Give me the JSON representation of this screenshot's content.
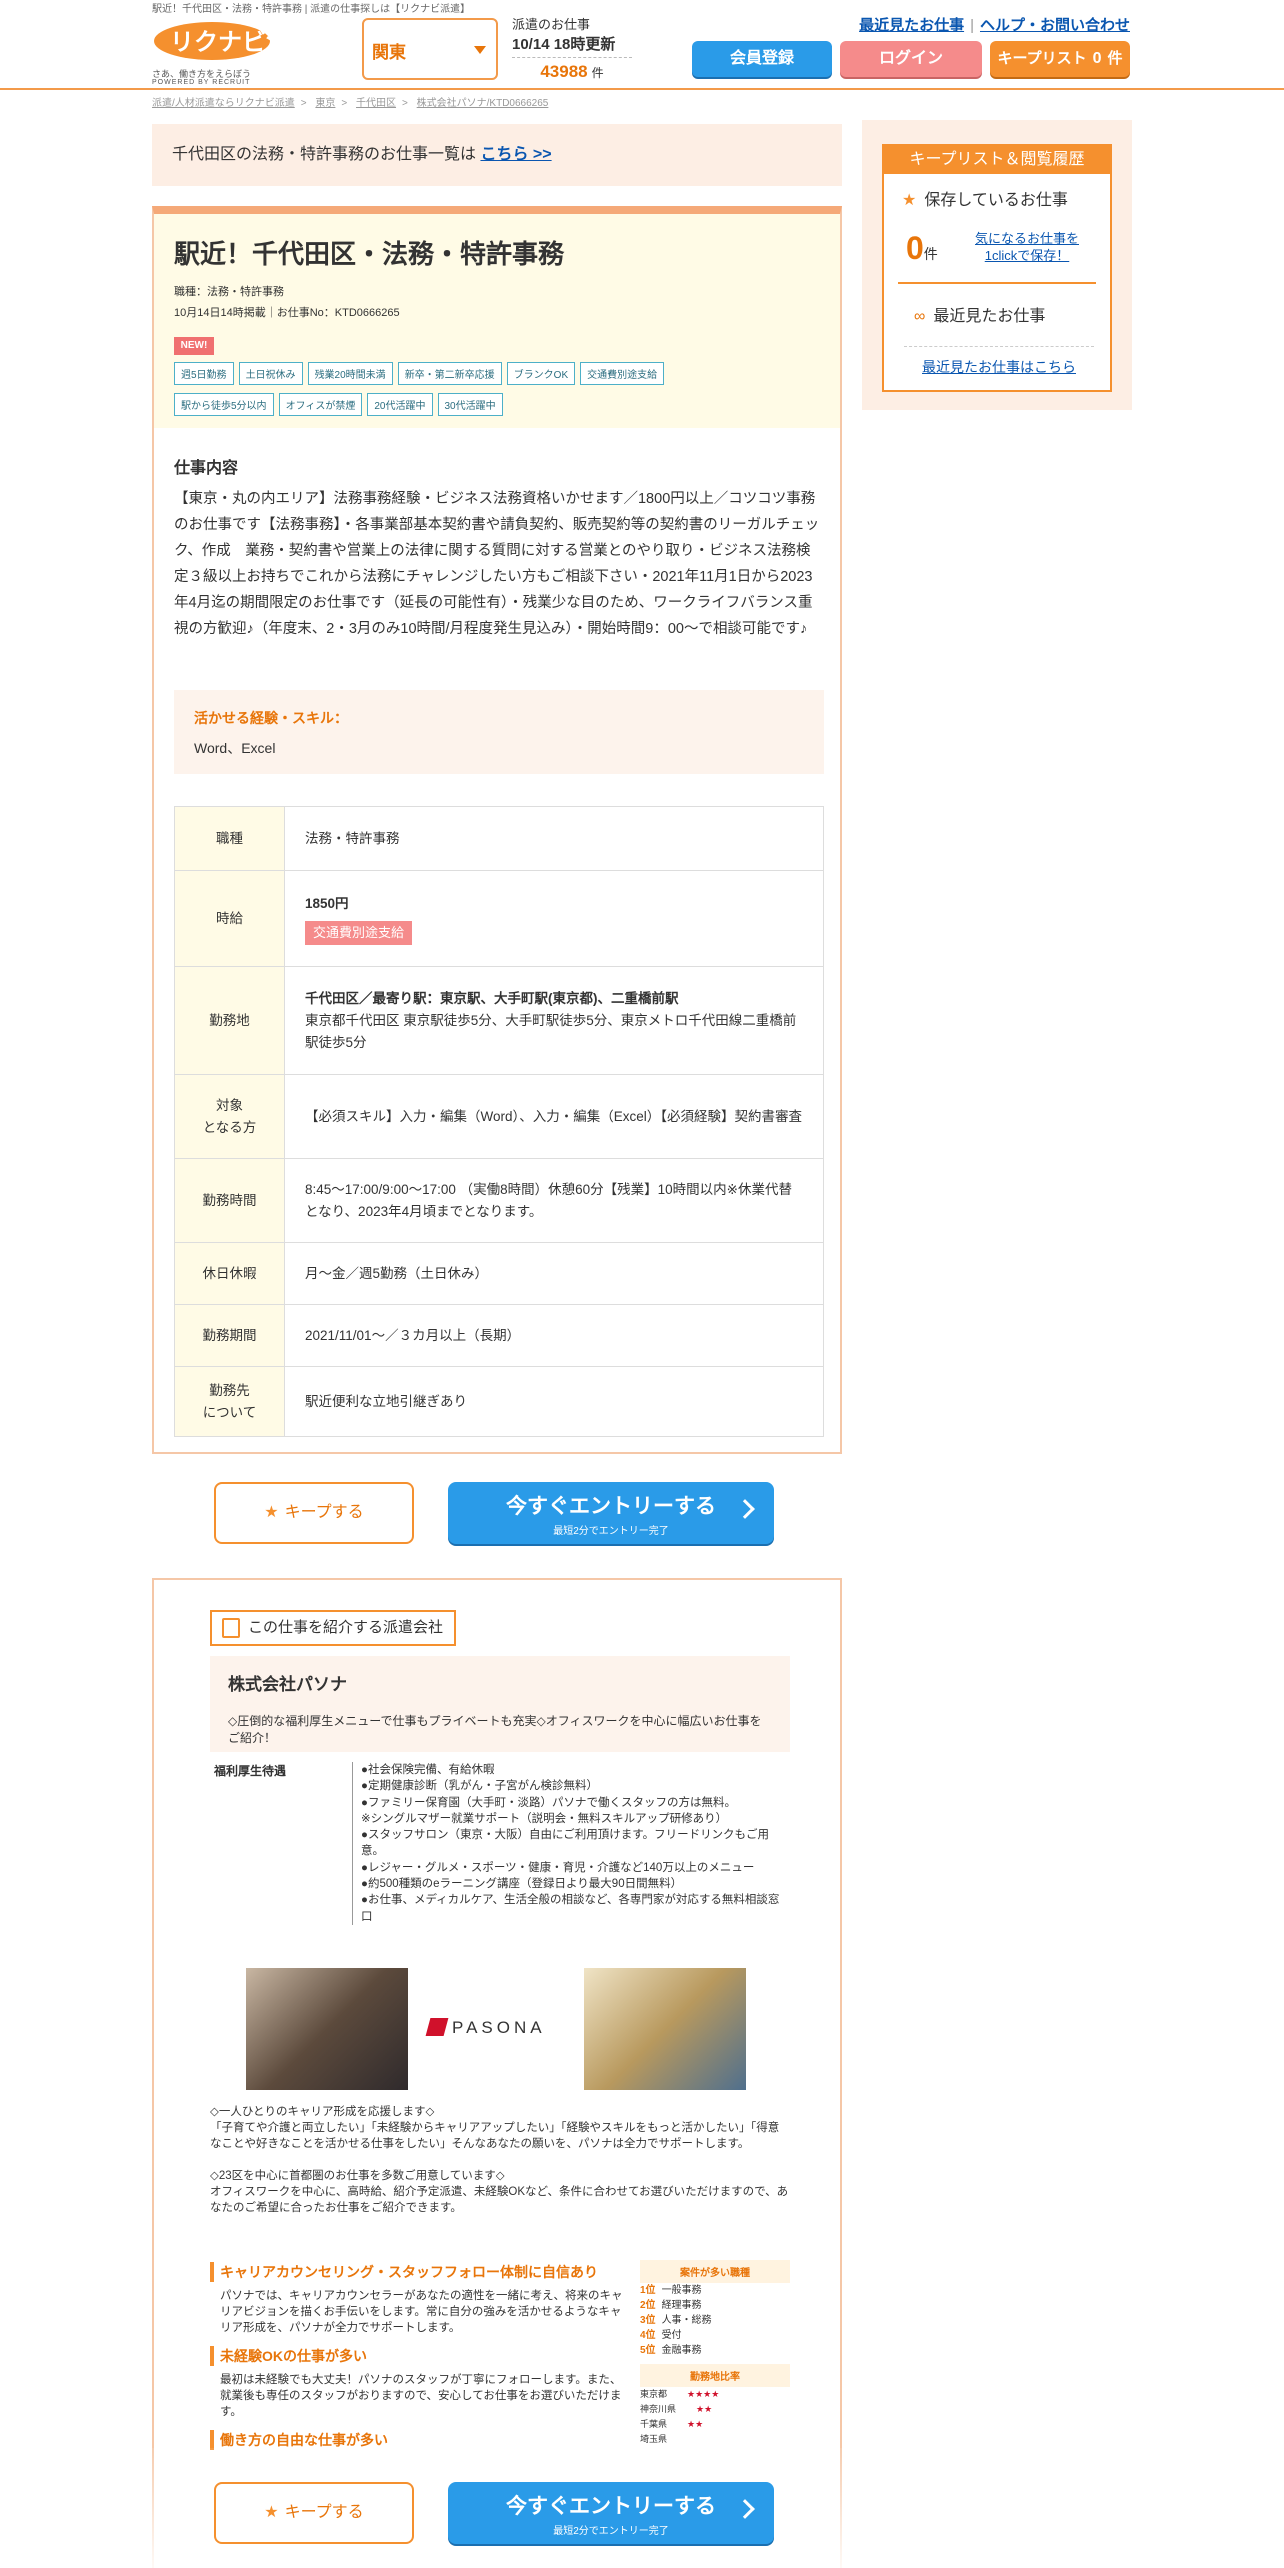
{
  "top_note": "駅近！千代田区・法務・特許事務 | 派遣の仕事探しは【リクナビ派遣】",
  "header": {
    "logo_text": "リクナビ派遣",
    "tagline": "さあ、働き方をえらぼう",
    "tagline2": "POWERED BY RECRUIT",
    "region": "関東",
    "jobs_label": "派遣のお仕事",
    "update": "10/14 18時更新",
    "job_count": "43988",
    "job_count_unit": "件",
    "link_recent": "最近見たお仕事",
    "link_help": "ヘルプ・お問い合わせ",
    "btn_member": "会員登録",
    "btn_login": "ログイン",
    "btn_keeplist": "キープリスト",
    "keeplist_count": "0",
    "keeplist_unit": "件"
  },
  "breadcrumb": [
    "派遣/人材派遣ならリクナビ派遣",
    "東京",
    "千代田区",
    "株式会社パソナ/KTD0666265"
  ],
  "notice": {
    "text": "千代田区の法務・特許事務のお仕事一覧は",
    "link": "こちら >>"
  },
  "job": {
    "title": "駅近！千代田区・法務・特許事務",
    "category_line": "職種：法務・特許事務",
    "posted_line": "10月14日14時掲載｜お仕事No：KTD0666265",
    "new_badge": "NEW!",
    "tags": [
      "週5日勤務",
      "土日祝休み",
      "残業20時間未満",
      "新卒・第二新卒応援",
      "ブランクOK",
      "交通費別途支給",
      "駅から徒歩5分以内",
      "オフィスが禁煙",
      "20代活躍中",
      "30代活躍中"
    ],
    "section_title": "仕事内容",
    "description": "【東京・丸の内エリア】法務事務経験・ビジネス法務資格いかせます／1800円以上／コツコツ事務のお仕事です【法務事務】・各事業部基本契約書や請負契約、販売契約等の契約書のリーガルチェック、作成　業務・契約書や営業上の法律に関する質問に対する営業とのやり取り・ビジネス法務検定３級以上お持ちでこれから法務にチャレンジしたい方もご相談下さい・2021年11月1日から2023年4月迄の期間限定のお仕事です（延長の可能性有）・残業少な目のため、ワークライフバランス重視の方歓迎♪（年度末、2・3月のみ10時間/月程度発生見込み）・開始時間9：00～で相談可能です♪",
    "skill_label": "活かせる経験・スキル：",
    "skill_value": "Word、Excel",
    "rows": [
      {
        "th": "職種",
        "tv": "法務・特許事務"
      },
      {
        "th": "時給",
        "strong": "1850円",
        "pill": "交通費別途支給"
      },
      {
        "th": "勤務地",
        "strong": "千代田区／最寄り駅：東京駅、大手町駅(東京都)、二重橋前駅",
        "tv": "東京都千代田区 東京駅徒歩5分、大手町駅徒歩5分、東京メトロ千代田線二重橋前駅徒歩5分"
      },
      {
        "th": "対象\nとなる方",
        "tv": "【必須スキル】入力・編集（Word）、入力・編集（Excel）【必須経験】契約書審査"
      },
      {
        "th": "勤務時間",
        "tv": "8:45～17:00/9:00～17:00 （実働8時間）休憩60分【残業】10時間以内※休業代替となり、2023年4月頃までとなります。"
      },
      {
        "th": "休日休暇",
        "tv": "月～金／週5勤務（土日休み）"
      },
      {
        "th": "勤務期間",
        "tv": "2021/11/01～／３カ月以上（長期）"
      },
      {
        "th": "勤務先\nについて",
        "tv": "駅近便利な立地引継ぎあり"
      }
    ]
  },
  "cta": {
    "keep": "キープする",
    "entry": "今すぐエントリーする",
    "entry_sub": "最短2分でエントリー完了"
  },
  "company": {
    "label": "この仕事を紹介する派遣会社",
    "name": "株式会社パソナ",
    "intro": "◇圧倒的な福利厚生メニューで仕事もプライベートも充実◇オフィスワークを中心に幅広いお仕事をご紹介！",
    "benefits_title": "福利厚生待遇",
    "benefits": "●社会保険完備、有給休暇\n●定期健康診断（乳がん・子宮がん検診無料）\n●ファミリー保育園（大手町・淡路）パソナで働くスタッフの方は無料。\n※シングルマザー就業サポート（説明会・無料スキルアップ研修あり）\n●スタッフサロン（東京・大阪）自由にご利用頂けます。フリードリンクもご用意。\n●レジャー・グルメ・スポーツ・健康・育児・介護など140万以上のメニュー\n●約500種類のeラーニング講座（登録日より最大90日間無料）\n●お仕事、メディカルケア、生活全般の相談など、各専門家が対応する無料相談窓口",
    "logo_text": "PASONA",
    "text": "◇一人ひとりのキャリア形成を応援します◇\n「子育てや介護と両立したい」「未経験からキャリアアップしたい」「経験やスキルをもっと活かしたい」「得意なことや好きなことを活かせる仕事をしたい」そんなあなたの願いを、パソナは全力でサポートします。\n\n◇23区を中心に首都圏のお仕事を多数ご用意しています◇\nオフィスワークを中心に、高時給、紹介予定派遣、未経験OKなど、条件に合わせてお選びいただけますので、あなたのご希望に合ったお仕事をご紹介できます。",
    "features": [
      {
        "h": "キャリアカウンセリング・スタッフフォロー体制に自信あり",
        "p": "パソナでは、キャリアカウンセラーがあなたの適性を一緒に考え、将来のキャリアビジョンを描くお手伝いをします。常に自分の強みを活かせるようなキャリア形成を、パソナが全力でサポートします。"
      },
      {
        "h": "未経験OKの仕事が多い",
        "p": "最初は未経験でも大丈夫！パソナのスタッフが丁寧にフォローします。また、就業後も専任のスタッフがおりますので、安心してお仕事をお選びいただけます。"
      },
      {
        "h": "働き方の自由な仕事が多い",
        "p": ""
      }
    ],
    "rank_title": "案件が多い職種",
    "ranks": [
      {
        "n": "1位",
        "v": "一般事務"
      },
      {
        "n": "2位",
        "v": "経理事務"
      },
      {
        "n": "3位",
        "v": "人事・総務"
      },
      {
        "n": "4位",
        "v": "受付"
      },
      {
        "n": "5位",
        "v": "金融事務"
      }
    ],
    "area_title": "勤務地比率",
    "areas": [
      {
        "p": "東京都",
        "s": "★★★★"
      },
      {
        "p": "神奈川県",
        "s": "★★"
      },
      {
        "p": "千葉県",
        "s": "★★"
      },
      {
        "p": "埼玉県",
        "s": ""
      }
    ]
  },
  "side": {
    "title": "キープリスト＆閲覧履歴",
    "keep_label": "保存しているお仕事",
    "count": "0",
    "unit": "件",
    "hint": "気になるお仕事を1clickで保存！",
    "recent_label": "最近見たお仕事",
    "recent_link": "最近見たお仕事はこちら"
  }
}
